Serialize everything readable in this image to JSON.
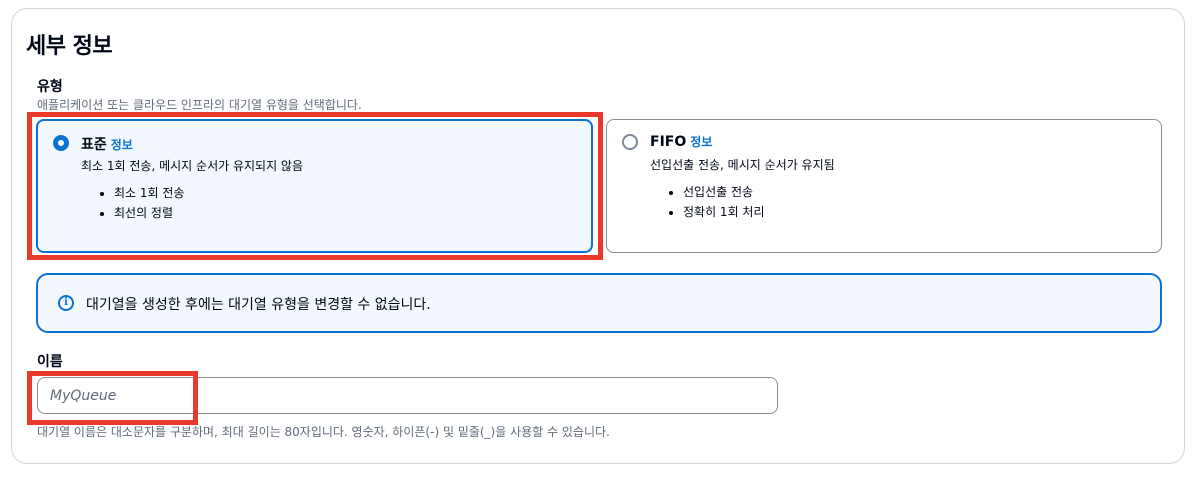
{
  "section": {
    "title": "세부 정보",
    "type": {
      "label": "유형",
      "description": "애플리케이션 또는 클라우드 인프라의 대기열 유형을 선택합니다.",
      "options": [
        {
          "title": "표준",
          "info_link": "정보",
          "description": "최소 1회 전송, 메시지 순서가 유지되지 않음",
          "bullets": [
            "최소 1회 전송",
            "최선의 정렬"
          ],
          "selected": true
        },
        {
          "title": "FIFO",
          "info_link": "정보",
          "description": "선입선출 전송, 메시지 순서가 유지됨",
          "bullets": [
            "선입선출 전송",
            "정확히 1회 처리"
          ],
          "selected": false
        }
      ]
    },
    "alert": {
      "icon": "info-icon",
      "text": "대기열을 생성한 후에는 대기열 유형을 변경할 수 없습니다."
    },
    "name": {
      "label": "이름",
      "placeholder": "MyQueue",
      "value": "",
      "hint": "대기열 이름은 대소문자를 구분하며, 최대 길이는 80자입니다. 영숫자, 하이픈(-) 및 밑줄(_)을 사용할 수 있습니다."
    }
  },
  "colors": {
    "accent": "#0972d3",
    "highlight": "#e8392a",
    "selected_bg": "#f2f8fd"
  }
}
